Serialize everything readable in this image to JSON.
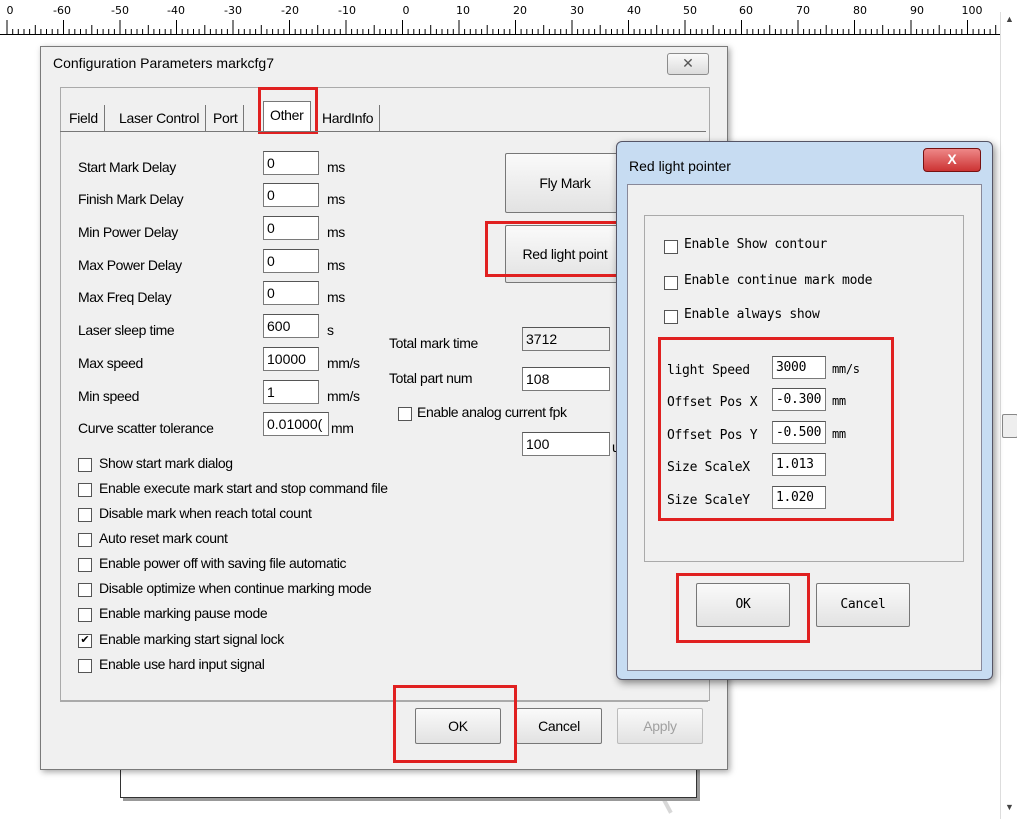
{
  "ruler": {
    "labels": [
      "0",
      "-60",
      "-50",
      "-40",
      "-30",
      "-20",
      "-10",
      "0",
      "10",
      "20",
      "30",
      "40",
      "50",
      "60",
      "70",
      "80",
      "90",
      "100"
    ]
  },
  "main_dialog": {
    "title": "Configuration Parameters markcfg7",
    "close_glyph": "✕",
    "tabs": [
      "Field",
      "Laser Control",
      "Port",
      "Other",
      "HardInfo"
    ],
    "active_tab": "Other",
    "params": [
      {
        "label": "Start Mark Delay",
        "value": "0",
        "unit": "ms"
      },
      {
        "label": "Finish Mark Delay",
        "value": "0",
        "unit": "ms"
      },
      {
        "label": "Min Power Delay",
        "value": "0",
        "unit": "ms"
      },
      {
        "label": "Max Power Delay",
        "value": "0",
        "unit": "ms"
      },
      {
        "label": "Max Freq Delay",
        "value": "0",
        "unit": "ms"
      },
      {
        "label": "Laser sleep time",
        "value": "600",
        "unit": "s"
      },
      {
        "label": "Max speed",
        "value": "10000",
        "unit": "mm/s"
      },
      {
        "label": "Min speed",
        "value": "1",
        "unit": "mm/s"
      },
      {
        "label": "Curve scatter tolerance",
        "value": "0.01000(",
        "unit": "mm"
      }
    ],
    "checkboxes": [
      {
        "label": "Show start mark dialog",
        "checked": false
      },
      {
        "label": "Enable execute mark start and stop command file",
        "checked": false
      },
      {
        "label": "Disable mark when reach total count",
        "checked": false
      },
      {
        "label": "Auto reset mark count",
        "checked": false
      },
      {
        "label": "Enable power off with saving file automatic",
        "checked": false
      },
      {
        "label": "Disable optimize when continue marking mode",
        "checked": false
      },
      {
        "label": "Enable marking pause mode",
        "checked": false
      },
      {
        "label": "Enable marking start signal lock",
        "checked": true
      },
      {
        "label": "Enable use hard input signal",
        "checked": false
      }
    ],
    "right": {
      "total_mark_time_label": "Total mark time",
      "total_mark_time_value": "3712",
      "total_part_num_label": "Total part num",
      "total_part_num_value": "108",
      "analog_label": "Enable analog current fpk",
      "analog_value": "100",
      "analog_unit": "u"
    },
    "buttons": {
      "fly_mark": "Fly Mark",
      "red_light": "Red light point",
      "ok": "OK",
      "cancel": "Cancel",
      "apply": "Apply"
    }
  },
  "red_dialog": {
    "title": "Red light pointer",
    "close_glyph": "X",
    "checkboxes": [
      {
        "label": "Enable Show contour",
        "checked": false
      },
      {
        "label": "Enable continue mark mode",
        "checked": false
      },
      {
        "label": "Enable always show",
        "checked": false
      }
    ],
    "fields": [
      {
        "label": "light Speed",
        "value": "3000",
        "unit": "mm/s"
      },
      {
        "label": "Offset Pos X",
        "value": "-0.300",
        "unit": "mm"
      },
      {
        "label": "Offset Pos Y",
        "value": "-0.500",
        "unit": "mm"
      },
      {
        "label": "Size ScaleX",
        "value": "1.013",
        "unit": ""
      },
      {
        "label": "Size ScaleY",
        "value": "1.020",
        "unit": ""
      }
    ],
    "ok": "OK",
    "cancel": "Cancel"
  },
  "colors": {
    "highlight": "#e02020",
    "dialog_frame": "#c7dcf2"
  }
}
